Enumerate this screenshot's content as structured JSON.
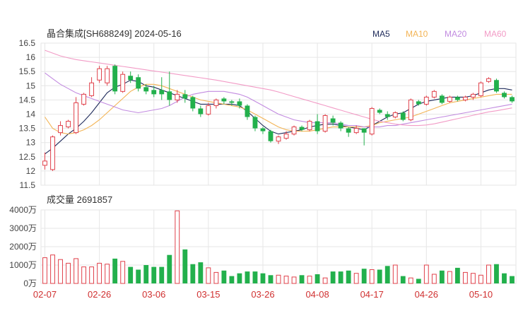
{
  "header": {
    "title": "晶合集成[SH688249] 2024-05-16"
  },
  "volume_header": {
    "title": "成交量 2691857"
  },
  "colors": {
    "up": "#e0404a",
    "down": "#22b04c",
    "grid": "#e6e6e6"
  },
  "legend": [
    {
      "name": "MA5",
      "color": "#1e2a5a"
    },
    {
      "name": "MA10",
      "color": "#f3b455"
    },
    {
      "name": "MA20",
      "color": "#c28be0"
    },
    {
      "name": "MA60",
      "color": "#f29bc6"
    }
  ],
  "chart_data": [
    {
      "type": "candlestick",
      "title": "晶合集成[SH688249] 2024-05-16",
      "ylim": [
        11.5,
        16.5
      ],
      "yticks": [
        "11.5",
        "12",
        "12.5",
        "13",
        "13.5",
        "14",
        "14.5",
        "15",
        "15.5",
        "16",
        "16.5"
      ],
      "xticks": [
        "02-07",
        "02-26",
        "03-06",
        "03-15",
        "03-26",
        "04-08",
        "04-17",
        "04-26",
        "05-10"
      ],
      "xtick_index": [
        0,
        7,
        14,
        21,
        28,
        35,
        42,
        49,
        56
      ],
      "ohlc": [
        [
          12.2,
          12.35,
          12.05,
          12.65
        ],
        [
          12.05,
          13.2,
          12.0,
          13.25
        ],
        [
          13.35,
          13.6,
          13.25,
          13.75
        ],
        [
          13.55,
          13.75,
          13.5,
          13.8
        ],
        [
          13.35,
          14.4,
          13.3,
          14.6
        ],
        [
          14.35,
          14.7,
          14.3,
          14.75
        ],
        [
          14.65,
          15.1,
          14.6,
          15.3
        ],
        [
          15.2,
          15.6,
          15.1,
          15.7
        ],
        [
          15.1,
          15.6,
          15.0,
          15.7
        ],
        [
          15.7,
          14.8,
          14.7,
          15.75
        ],
        [
          14.8,
          15.4,
          14.75,
          15.5
        ],
        [
          15.35,
          15.2,
          15.1,
          15.5
        ],
        [
          15.3,
          14.9,
          14.8,
          15.4
        ],
        [
          14.95,
          14.8,
          14.7,
          15.05
        ],
        [
          14.85,
          14.7,
          14.6,
          15.0
        ],
        [
          14.85,
          14.7,
          14.5,
          15.3
        ],
        [
          14.8,
          14.5,
          14.3,
          15.5
        ],
        [
          14.5,
          14.7,
          14.4,
          14.85
        ],
        [
          14.7,
          14.55,
          14.4,
          14.85
        ],
        [
          14.6,
          14.2,
          14.1,
          14.65
        ],
        [
          14.2,
          14.0,
          13.9,
          14.3
        ],
        [
          14.0,
          14.3,
          13.95,
          14.4
        ],
        [
          14.3,
          14.5,
          14.2,
          14.55
        ],
        [
          14.55,
          14.45,
          14.35,
          14.6
        ],
        [
          14.45,
          14.4,
          14.3,
          14.5
        ],
        [
          14.45,
          14.3,
          14.2,
          14.55
        ],
        [
          14.3,
          13.9,
          13.8,
          14.35
        ],
        [
          13.9,
          13.5,
          13.4,
          13.95
        ],
        [
          13.5,
          13.4,
          13.3,
          13.55
        ],
        [
          13.4,
          13.05,
          13.0,
          13.45
        ],
        [
          13.05,
          13.2,
          12.95,
          13.25
        ],
        [
          13.15,
          13.3,
          13.1,
          13.4
        ],
        [
          13.3,
          13.55,
          13.25,
          13.6
        ],
        [
          13.55,
          13.45,
          13.4,
          13.6
        ],
        [
          13.45,
          13.75,
          13.4,
          13.8
        ],
        [
          13.75,
          13.4,
          13.3,
          14.0
        ],
        [
          13.4,
          13.95,
          13.35,
          14.0
        ],
        [
          13.85,
          13.7,
          13.6,
          13.95
        ],
        [
          13.7,
          13.5,
          13.4,
          13.75
        ],
        [
          13.5,
          13.35,
          13.2,
          13.55
        ],
        [
          13.35,
          13.5,
          13.3,
          13.6
        ],
        [
          13.5,
          13.35,
          12.9,
          13.5
        ],
        [
          13.3,
          14.2,
          13.25,
          14.25
        ],
        [
          14.15,
          14.05,
          14.0,
          14.2
        ],
        [
          14.0,
          13.9,
          13.8,
          14.1
        ],
        [
          13.9,
          14.05,
          13.85,
          14.1
        ],
        [
          14.05,
          13.8,
          13.75,
          14.1
        ],
        [
          13.8,
          14.5,
          13.75,
          14.55
        ],
        [
          14.45,
          14.35,
          14.3,
          14.5
        ],
        [
          14.35,
          14.6,
          14.3,
          14.65
        ],
        [
          14.6,
          14.8,
          14.55,
          14.85
        ],
        [
          14.65,
          14.4,
          14.35,
          14.7
        ],
        [
          14.45,
          14.6,
          14.4,
          14.65
        ],
        [
          14.6,
          14.5,
          14.45,
          14.65
        ],
        [
          14.5,
          14.6,
          14.45,
          14.65
        ],
        [
          14.6,
          14.7,
          14.5,
          14.75
        ],
        [
          14.65,
          15.1,
          14.6,
          15.15
        ],
        [
          15.15,
          15.25,
          15.1,
          15.3
        ],
        [
          15.2,
          14.8,
          14.75,
          15.25
        ],
        [
          14.75,
          14.6,
          14.55,
          14.8
        ],
        [
          14.6,
          14.45,
          14.4,
          14.65
        ]
      ],
      "ma": {
        "MA5": [
          12.6,
          12.8,
          13.05,
          13.3,
          13.5,
          13.75,
          14.05,
          14.4,
          14.75,
          14.95,
          15.05,
          15.2,
          15.15,
          15.0,
          14.95,
          14.85,
          14.75,
          14.65,
          14.55,
          14.45,
          14.35,
          14.35,
          14.35,
          14.35,
          14.35,
          14.3,
          14.1,
          13.85,
          13.6,
          13.4,
          13.3,
          13.35,
          13.4,
          13.45,
          13.55,
          13.6,
          13.65,
          13.65,
          13.6,
          13.55,
          13.5,
          13.45,
          13.6,
          13.75,
          13.9,
          14.0,
          14.05,
          14.2,
          14.35,
          14.45,
          14.5,
          14.55,
          14.6,
          14.6,
          14.6,
          14.65,
          14.75,
          14.85,
          14.9,
          14.9,
          14.85
        ],
        "MA10": [
          13.9,
          13.5,
          13.35,
          13.3,
          13.35,
          13.45,
          13.6,
          13.8,
          14.05,
          14.3,
          14.55,
          14.8,
          14.95,
          15.05,
          15.05,
          15.0,
          14.9,
          14.8,
          14.7,
          14.6,
          14.5,
          14.45,
          14.4,
          14.35,
          14.3,
          14.25,
          14.15,
          14.0,
          13.85,
          13.7,
          13.55,
          13.45,
          13.4,
          13.4,
          13.4,
          13.45,
          13.5,
          13.55,
          13.55,
          13.55,
          13.55,
          13.55,
          13.6,
          13.7,
          13.75,
          13.8,
          13.85,
          13.9,
          14.0,
          14.1,
          14.2,
          14.3,
          14.4,
          14.45,
          14.5,
          14.55,
          14.6,
          14.65,
          14.7,
          14.7,
          14.7
        ],
        "MA20": [
          15.45,
          15.25,
          15.05,
          14.9,
          14.75,
          14.65,
          14.55,
          14.45,
          14.35,
          14.25,
          14.15,
          14.1,
          14.05,
          14.1,
          14.15,
          14.2,
          14.3,
          14.45,
          14.6,
          14.7,
          14.75,
          14.8,
          14.8,
          14.8,
          14.75,
          14.7,
          14.6,
          14.45,
          14.3,
          14.15,
          14.0,
          13.9,
          13.8,
          13.75,
          13.7,
          13.7,
          13.7,
          13.7,
          13.65,
          13.6,
          13.6,
          13.55,
          13.55,
          13.55,
          13.6,
          13.6,
          13.65,
          13.7,
          13.75,
          13.8,
          13.85,
          13.9,
          13.95,
          14.0,
          14.05,
          14.1,
          14.15,
          14.2,
          14.25,
          14.3,
          14.35
        ],
        "MA60": [
          16.25,
          16.15,
          16.05,
          15.98,
          15.92,
          15.88,
          15.84,
          15.8,
          15.76,
          15.72,
          15.68,
          15.64,
          15.6,
          15.56,
          15.52,
          15.48,
          15.44,
          15.4,
          15.36,
          15.32,
          15.28,
          15.24,
          15.2,
          15.15,
          15.1,
          15.05,
          15.0,
          14.95,
          14.9,
          14.85,
          14.78,
          14.7,
          14.62,
          14.54,
          14.46,
          14.38,
          14.3,
          14.22,
          14.14,
          14.06,
          13.98,
          13.9,
          13.82,
          13.75,
          13.7,
          13.65,
          13.62,
          13.6,
          13.6,
          13.62,
          13.66,
          13.72,
          13.78,
          13.84,
          13.9,
          13.96,
          14.02,
          14.08,
          14.12,
          14.17,
          14.22
        ]
      }
    },
    {
      "type": "bar",
      "title": "成交量 2691857",
      "unit": "万",
      "ylim": [
        0,
        4000
      ],
      "yticks": [
        "0万",
        "1000万",
        "2000万",
        "3000万",
        "4000万"
      ],
      "values": [
        1400,
        1550,
        1300,
        1100,
        1350,
        900,
        900,
        1100,
        1050,
        1350,
        1200,
        900,
        750,
        1000,
        900,
        900,
        1550,
        3950,
        1850,
        1050,
        1150,
        850,
        600,
        700,
        400,
        550,
        650,
        650,
        550,
        450,
        450,
        400,
        350,
        450,
        400,
        500,
        300,
        650,
        650,
        700,
        550,
        800,
        750,
        750,
        950,
        1000,
        400,
        300,
        250,
        1000,
        500,
        700,
        650,
        850,
        600,
        550,
        450,
        1000,
        1050,
        550,
        400,
        300
      ]
    }
  ]
}
